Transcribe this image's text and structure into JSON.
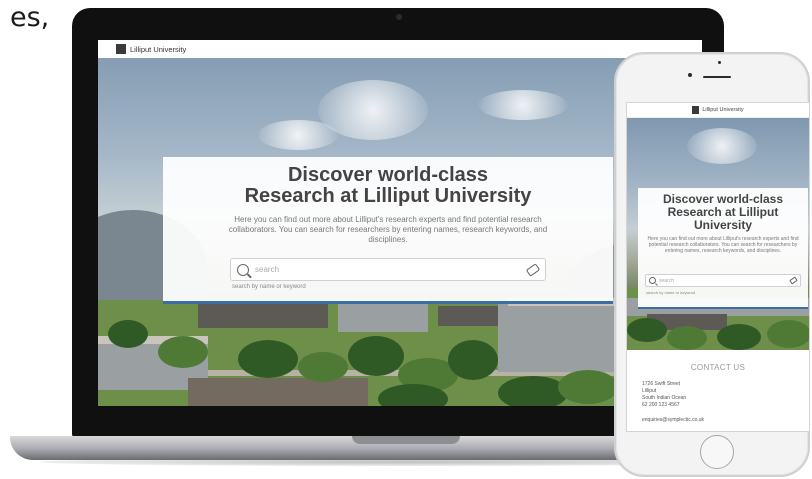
{
  "caption": {
    "fragment": "es,"
  },
  "site": {
    "brand": "Lilliput University",
    "hero": {
      "title_line1": "Discover world-class",
      "title_line2": "Research at Lilliput University",
      "description": "Here you can find out more about Lilliput's research experts and find potential research collaborators.  You can search for researchers by entering names, research keywords, and disciplines."
    },
    "search": {
      "placeholder": "search",
      "hint": "search by name or keyword"
    }
  },
  "mobile": {
    "brand": "Lilliput University",
    "hero": {
      "title": "Discover world-class Research at Lilliput University",
      "description": "Here you can find out more about Lilliput's research experts and find potential research collaborators.  You can search for researchers by entering names, research keywords, and disciplines."
    },
    "search": {
      "placeholder": "search",
      "hint": "search by name or keyword"
    },
    "contact": {
      "title": "CONTACT US",
      "address_line1": "1726 Swift Street",
      "address_line2": "Lilliput",
      "address_line3": "South Indian Ocean",
      "phone": "62 200 123 4567",
      "email": "enquiries@symplectic.co.uk"
    }
  },
  "icons": {
    "search": "search-icon",
    "keyword_tag": "tag-icon",
    "logo": "university-logo-icon"
  },
  "colors": {
    "accent": "#3b6ea5",
    "title_text": "#444444",
    "body_text": "#777777"
  }
}
